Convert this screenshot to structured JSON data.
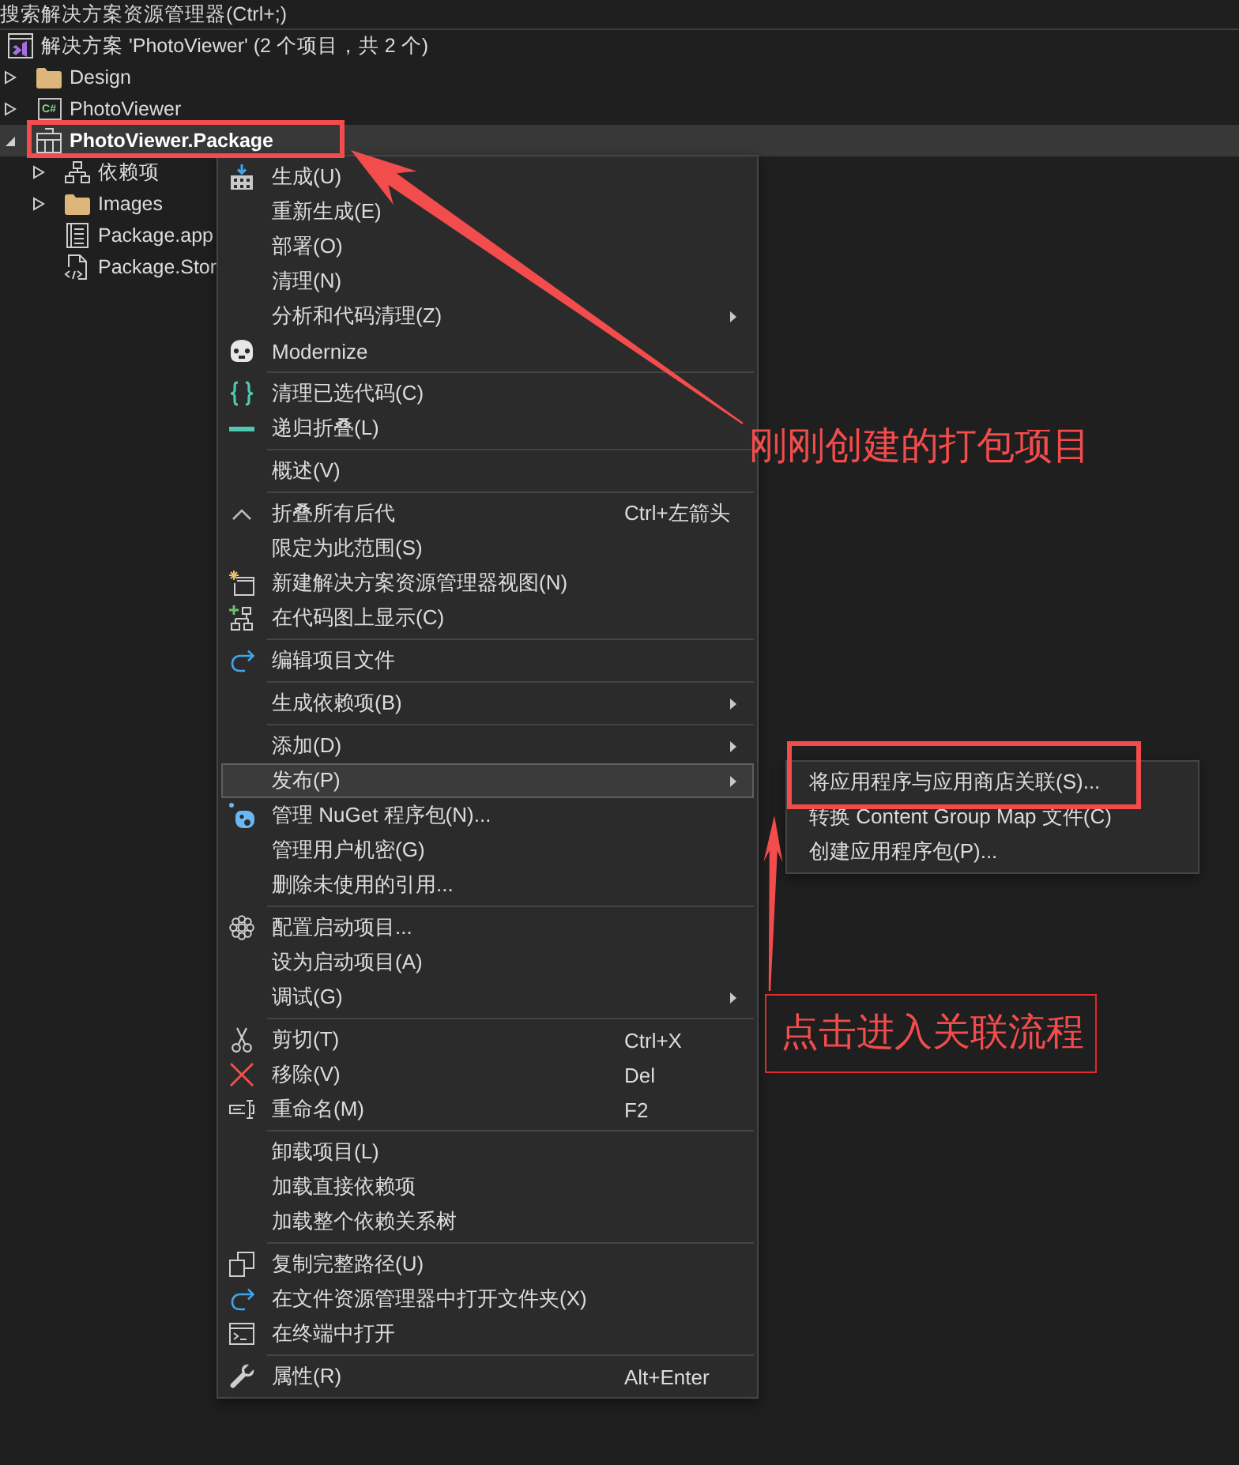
{
  "solution_explorer": {
    "search": {
      "placeholder": "搜索解决方案资源管理器(Ctrl+;)"
    },
    "solution": {
      "label": "解决方案 'PhotoViewer' (2 个项目，共 2 个)",
      "selected": false
    },
    "items": [
      {
        "label": "Design",
        "kind": "folder",
        "expanded": false,
        "selected": false,
        "startup": false
      },
      {
        "label": "PhotoViewer",
        "kind": "csharp-project",
        "badge": "C#",
        "expanded": false,
        "selected": false,
        "startup": false
      },
      {
        "label": "PhotoViewer.Package",
        "kind": "package-project",
        "expanded": true,
        "selected": true,
        "startup": true,
        "children": [
          {
            "label": "依赖项",
            "kind": "dependencies",
            "expanded": false,
            "selected": false
          },
          {
            "label": "Images",
            "kind": "folder",
            "expanded": false,
            "selected": false
          },
          {
            "label": "Package.app",
            "kind": "manifest",
            "selected": false
          },
          {
            "label": "Package.Stor",
            "kind": "code-file",
            "selected": false
          }
        ]
      }
    ]
  },
  "context_menu": {
    "groups": [
      {
        "items": [
          {
            "label": "生成(U)",
            "submenu": false,
            "selected": false
          },
          {
            "label": "重新生成(E)",
            "submenu": false,
            "selected": false
          },
          {
            "label": "部署(O)",
            "submenu": false,
            "selected": false
          },
          {
            "label": "清理(N)",
            "submenu": false,
            "selected": false
          },
          {
            "label": "分析和代码清理(Z)",
            "submenu": true,
            "selected": false
          },
          {
            "label": "Modernize",
            "submenu": false,
            "selected": false
          }
        ]
      },
      {
        "items": [
          {
            "label": "清理已选代码(C)",
            "submenu": false,
            "selected": false
          },
          {
            "label": "递归折叠(L)",
            "submenu": false,
            "selected": false
          }
        ]
      },
      {
        "items": [
          {
            "label": "概述(V)",
            "submenu": false,
            "selected": false
          }
        ]
      },
      {
        "items": [
          {
            "label": "折叠所有后代",
            "shortcut": "Ctrl+左箭头",
            "submenu": false,
            "selected": false
          },
          {
            "label": "限定为此范围(S)",
            "submenu": false,
            "selected": false
          },
          {
            "label": "新建解决方案资源管理器视图(N)",
            "submenu": false,
            "selected": false
          },
          {
            "label": "在代码图上显示(C)",
            "submenu": false,
            "selected": false
          }
        ]
      },
      {
        "items": [
          {
            "label": "编辑项目文件",
            "submenu": false,
            "selected": false
          }
        ]
      },
      {
        "items": [
          {
            "label": "生成依赖项(B)",
            "submenu": true,
            "selected": false
          }
        ]
      },
      {
        "items": [
          {
            "label": "添加(D)",
            "submenu": true,
            "selected": false
          },
          {
            "label": "发布(P)",
            "submenu": true,
            "selected": true
          },
          {
            "label": "管理 NuGet 程序包(N)...",
            "submenu": false,
            "selected": false
          },
          {
            "label": "管理用户机密(G)",
            "submenu": false,
            "selected": false
          },
          {
            "label": "删除未使用的引用...",
            "submenu": false,
            "selected": false
          }
        ]
      },
      {
        "items": [
          {
            "label": "配置启动项目...",
            "submenu": false,
            "selected": false
          },
          {
            "label": "设为启动项目(A)",
            "submenu": false,
            "selected": false
          },
          {
            "label": "调试(G)",
            "submenu": true,
            "selected": false
          }
        ]
      },
      {
        "items": [
          {
            "label": "剪切(T)",
            "shortcut": "Ctrl+X",
            "submenu": false,
            "selected": false
          },
          {
            "label": "移除(V)",
            "shortcut": "Del",
            "submenu": false,
            "selected": false
          },
          {
            "label": "重命名(M)",
            "shortcut": "F2",
            "submenu": false,
            "selected": false
          }
        ]
      },
      {
        "items": [
          {
            "label": "卸载项目(L)",
            "submenu": false,
            "selected": false
          },
          {
            "label": "加载直接依赖项",
            "submenu": false,
            "selected": false
          },
          {
            "label": "加载整个依赖关系树",
            "submenu": false,
            "selected": false
          }
        ]
      },
      {
        "items": [
          {
            "label": "复制完整路径(U)",
            "submenu": false,
            "selected": false
          },
          {
            "label": "在文件资源管理器中打开文件夹(X)",
            "submenu": false,
            "selected": false
          },
          {
            "label": "在终端中打开",
            "submenu": false,
            "selected": false
          }
        ]
      },
      {
        "items": [
          {
            "label": "属性(R)",
            "shortcut": "Alt+Enter",
            "submenu": false,
            "selected": false
          }
        ]
      }
    ]
  },
  "publish_submenu": {
    "items": [
      {
        "label": "将应用程序与应用商店关联(S)...",
        "selected": false
      },
      {
        "label": "转换 Content Group Map 文件(C)",
        "selected": false
      },
      {
        "label": "创建应用程序包(P)...",
        "selected": false
      }
    ]
  },
  "annotations": [
    {
      "kind": "plain",
      "text": "刚刚创建的打包项目"
    },
    {
      "kind": "boxed",
      "text": "点击进入关联流程"
    }
  ]
}
